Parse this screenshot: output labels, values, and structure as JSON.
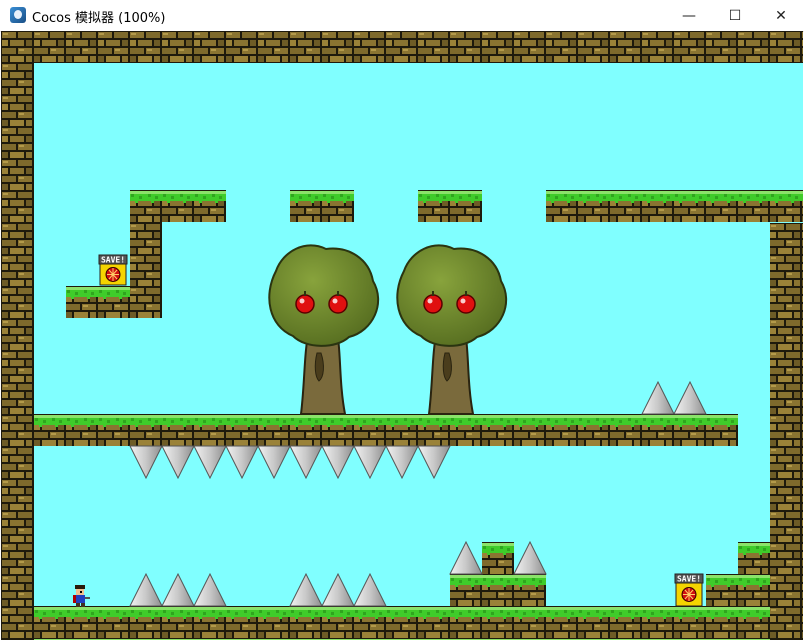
{
  "window": {
    "title": "Cocos 模拟器 (100%)",
    "icon": "cocos-simulator-icon",
    "controls": {
      "minimize": "—",
      "maximize": "☐",
      "close": "✕"
    }
  },
  "game": {
    "save_label": "SAVE!",
    "colors": {
      "sky": "#80ffff",
      "grass": "#3fcc2a",
      "grass_light": "#8be36a",
      "brick": "#8a7431",
      "brick_dark": "#3d3318",
      "brick_mortar": "#1e1a0c",
      "spike": "#d0d0d0",
      "tree_leaves": "#6f8a2e",
      "trunk": "#7a6a3c",
      "apple": "#e01010"
    }
  }
}
